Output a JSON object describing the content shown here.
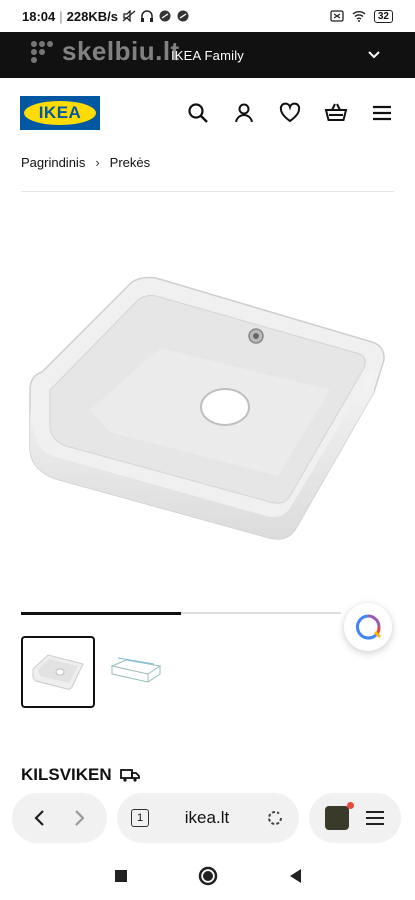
{
  "status": {
    "time": "18:04",
    "speed": "228KB/s",
    "battery": "32"
  },
  "family_bar": {
    "label": "IKEA Family",
    "watermark": "skelbiu.lt"
  },
  "header": {
    "logo_text": "IKEA",
    "icons": [
      "search-icon",
      "user-icon",
      "heart-icon",
      "basket-icon",
      "menu-icon"
    ]
  },
  "breadcrumb": {
    "items": [
      "Pagrindinis",
      "Prekės"
    ]
  },
  "gallery": {
    "progress": 0.5
  },
  "product": {
    "title": "KILSVIKEN"
  },
  "browser": {
    "url": "ikea.lt",
    "tab_count": "1"
  },
  "colors": {
    "brand_blue": "#0058a3",
    "brand_yellow": "#ffdb00"
  }
}
